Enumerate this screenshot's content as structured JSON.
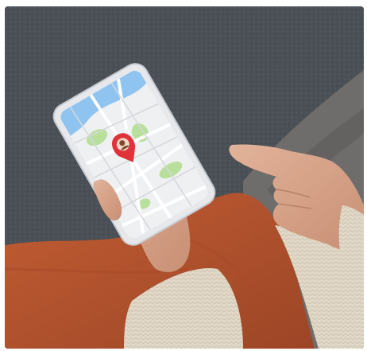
{
  "image": {
    "subject": "",
    "colors": {
      "background_carpet": "#4a5055",
      "sofa": "#6e6c6c",
      "skirt": "#b4542f",
      "sweater": "#e0d6c6",
      "skin": "#d9a88e",
      "phone_frame": "#e6e8ec",
      "map_base": "#eef0f2",
      "map_park": "#b9df9c",
      "map_water": "#8fc4f0",
      "pin": "#e0323a"
    },
    "elements": {
      "phone": "smartphone-in-hand",
      "map": "map-app-screen",
      "pin": "location-pin-icon",
      "left_hand": "left-hand",
      "right_hand": "pointing-right-hand"
    }
  }
}
